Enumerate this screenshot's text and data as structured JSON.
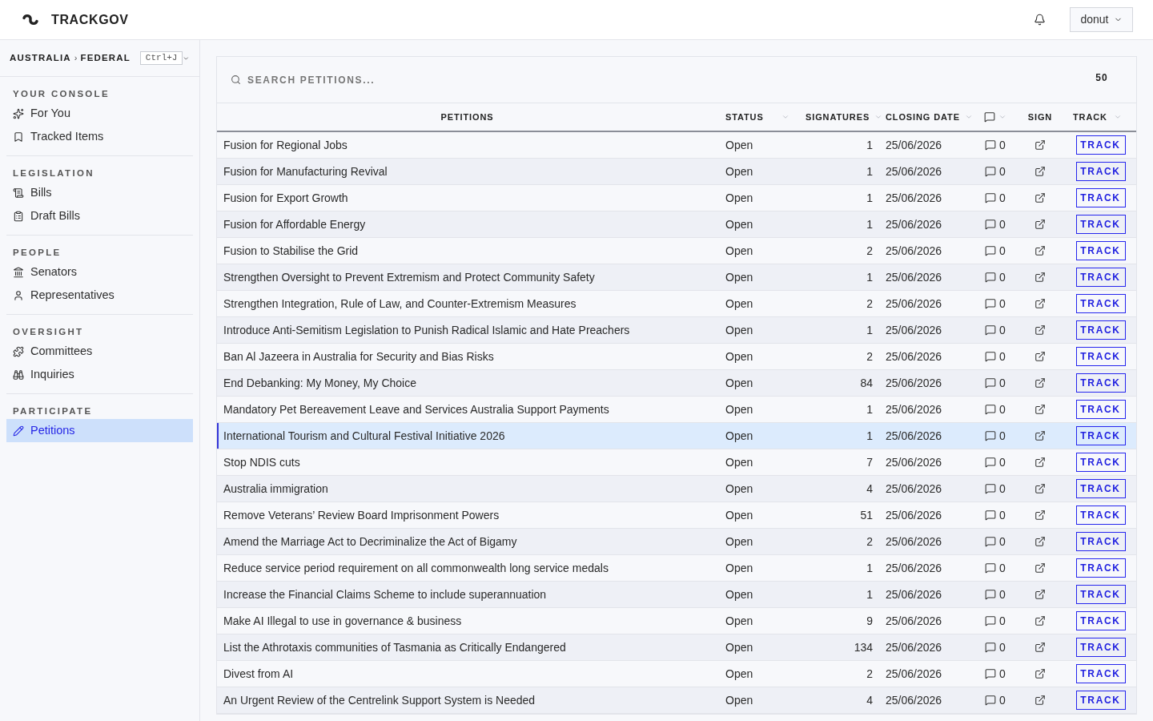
{
  "header": {
    "brand": "TRACKGOV",
    "user_menu": "donut"
  },
  "sidebar": {
    "breadcrumb": [
      "AUSTRALIA",
      "FEDERAL"
    ],
    "separator": "›",
    "shortcut": "Ctrl+J",
    "sections": [
      {
        "title": "YOUR CONSOLE",
        "items": [
          {
            "label": "For You",
            "selected": false
          },
          {
            "label": "Tracked Items",
            "selected": false
          }
        ]
      },
      {
        "title": "LEGISLATION",
        "items": [
          {
            "label": "Bills",
            "selected": false
          },
          {
            "label": "Draft Bills",
            "selected": false
          }
        ]
      },
      {
        "title": "PEOPLE",
        "items": [
          {
            "label": "Senators",
            "selected": false
          },
          {
            "label": "Representatives",
            "selected": false
          }
        ]
      },
      {
        "title": "OVERSIGHT",
        "items": [
          {
            "label": "Committees",
            "selected": false
          },
          {
            "label": "Inquiries",
            "selected": false
          }
        ]
      },
      {
        "title": "PARTICIPATE",
        "items": [
          {
            "label": "Petitions",
            "selected": true
          }
        ]
      }
    ]
  },
  "petitions": {
    "search": {
      "placeholder": "SEARCH PETITIONS..."
    },
    "count": "50",
    "columns": [
      {
        "kind": "text",
        "label": "PETITIONS",
        "sortable": false
      },
      {
        "kind": "text",
        "label": "STATUS",
        "sortable": true
      },
      {
        "kind": "text",
        "label": "SIGNATURES",
        "sortable": true
      },
      {
        "kind": "text",
        "label": "CLOSING DATE",
        "sortable": true
      },
      {
        "kind": "icon",
        "sortable": true
      },
      {
        "kind": "text",
        "label": "SIGN",
        "sortable": false
      },
      {
        "kind": "text",
        "label": "TRACK",
        "sortable": true
      }
    ],
    "rows": [
      {
        "title": "Fusion for Regional Jobs",
        "status": "Open",
        "signatures": "1",
        "closing_date": "25/06/2026",
        "comments": "0",
        "action": "TRACK",
        "selected": false
      },
      {
        "title": "Fusion for Manufacturing Revival",
        "status": "Open",
        "signatures": "1",
        "closing_date": "25/06/2026",
        "comments": "0",
        "action": "TRACK",
        "selected": false
      },
      {
        "title": "Fusion for Export Growth",
        "status": "Open",
        "signatures": "1",
        "closing_date": "25/06/2026",
        "comments": "0",
        "action": "TRACK",
        "selected": false
      },
      {
        "title": "Fusion for Affordable Energy",
        "status": "Open",
        "signatures": "1",
        "closing_date": "25/06/2026",
        "comments": "0",
        "action": "TRACK",
        "selected": false
      },
      {
        "title": "Fusion to Stabilise the Grid",
        "status": "Open",
        "signatures": "2",
        "closing_date": "25/06/2026",
        "comments": "0",
        "action": "TRACK",
        "selected": false
      },
      {
        "title": "Strengthen Oversight to Prevent Extremism and Protect Community Safety",
        "status": "Open",
        "signatures": "1",
        "closing_date": "25/06/2026",
        "comments": "0",
        "action": "TRACK",
        "selected": false
      },
      {
        "title": "Strengthen Integration, Rule of Law, and Counter-Extremism Measures",
        "status": "Open",
        "signatures": "2",
        "closing_date": "25/06/2026",
        "comments": "0",
        "action": "TRACK",
        "selected": false
      },
      {
        "title": "Introduce Anti-Semitism Legislation to Punish Radical Islamic and Hate Preachers",
        "status": "Open",
        "signatures": "1",
        "closing_date": "25/06/2026",
        "comments": "0",
        "action": "TRACK",
        "selected": false
      },
      {
        "title": "Ban Al Jazeera in Australia for Security and Bias Risks",
        "status": "Open",
        "signatures": "2",
        "closing_date": "25/06/2026",
        "comments": "0",
        "action": "TRACK",
        "selected": false
      },
      {
        "title": "End Debanking: My Money, My Choice",
        "status": "Open",
        "signatures": "84",
        "closing_date": "25/06/2026",
        "comments": "0",
        "action": "TRACK",
        "selected": false
      },
      {
        "title": "Mandatory Pet Bereavement Leave and Services Australia Support Payments",
        "status": "Open",
        "signatures": "1",
        "closing_date": "25/06/2026",
        "comments": "0",
        "action": "TRACK",
        "selected": false
      },
      {
        "title": "International Tourism and Cultural Festival Initiative 2026",
        "status": "Open",
        "signatures": "1",
        "closing_date": "25/06/2026",
        "comments": "0",
        "action": "TRACK",
        "selected": true
      },
      {
        "title": "Stop NDIS cuts",
        "status": "Open",
        "signatures": "7",
        "closing_date": "25/06/2026",
        "comments": "0",
        "action": "TRACK",
        "selected": false
      },
      {
        "title": "Australia immigration",
        "status": "Open",
        "signatures": "4",
        "closing_date": "25/06/2026",
        "comments": "0",
        "action": "TRACK",
        "selected": false
      },
      {
        "title": "Remove Veterans’ Review Board Imprisonment Powers",
        "status": "Open",
        "signatures": "51",
        "closing_date": "25/06/2026",
        "comments": "0",
        "action": "TRACK",
        "selected": false
      },
      {
        "title": "Amend the Marriage Act to Decriminalize the Act of Bigamy",
        "status": "Open",
        "signatures": "2",
        "closing_date": "25/06/2026",
        "comments": "0",
        "action": "TRACK",
        "selected": false
      },
      {
        "title": "Reduce service period requirement on all commonwealth long service medals",
        "status": "Open",
        "signatures": "1",
        "closing_date": "25/06/2026",
        "comments": "0",
        "action": "TRACK",
        "selected": false
      },
      {
        "title": "Increase the Financial Claims Scheme to include superannuation",
        "status": "Open",
        "signatures": "1",
        "closing_date": "25/06/2026",
        "comments": "0",
        "action": "TRACK",
        "selected": false
      },
      {
        "title": "Make AI Illegal to use in governance & business",
        "status": "Open",
        "signatures": "9",
        "closing_date": "25/06/2026",
        "comments": "0",
        "action": "TRACK",
        "selected": false
      },
      {
        "title": "List the Athrotaxis communities of Tasmania as Critically Endangered",
        "status": "Open",
        "signatures": "134",
        "closing_date": "25/06/2026",
        "comments": "0",
        "action": "TRACK",
        "selected": false
      },
      {
        "title": "Divest from AI",
        "status": "Open",
        "signatures": "2",
        "closing_date": "25/06/2026",
        "comments": "0",
        "action": "TRACK",
        "selected": false
      },
      {
        "title": "An Urgent Review of the Centrelink Support System is Needed",
        "status": "Open",
        "signatures": "4",
        "closing_date": "25/06/2026",
        "comments": "0",
        "action": "TRACK",
        "selected": false
      }
    ]
  }
}
